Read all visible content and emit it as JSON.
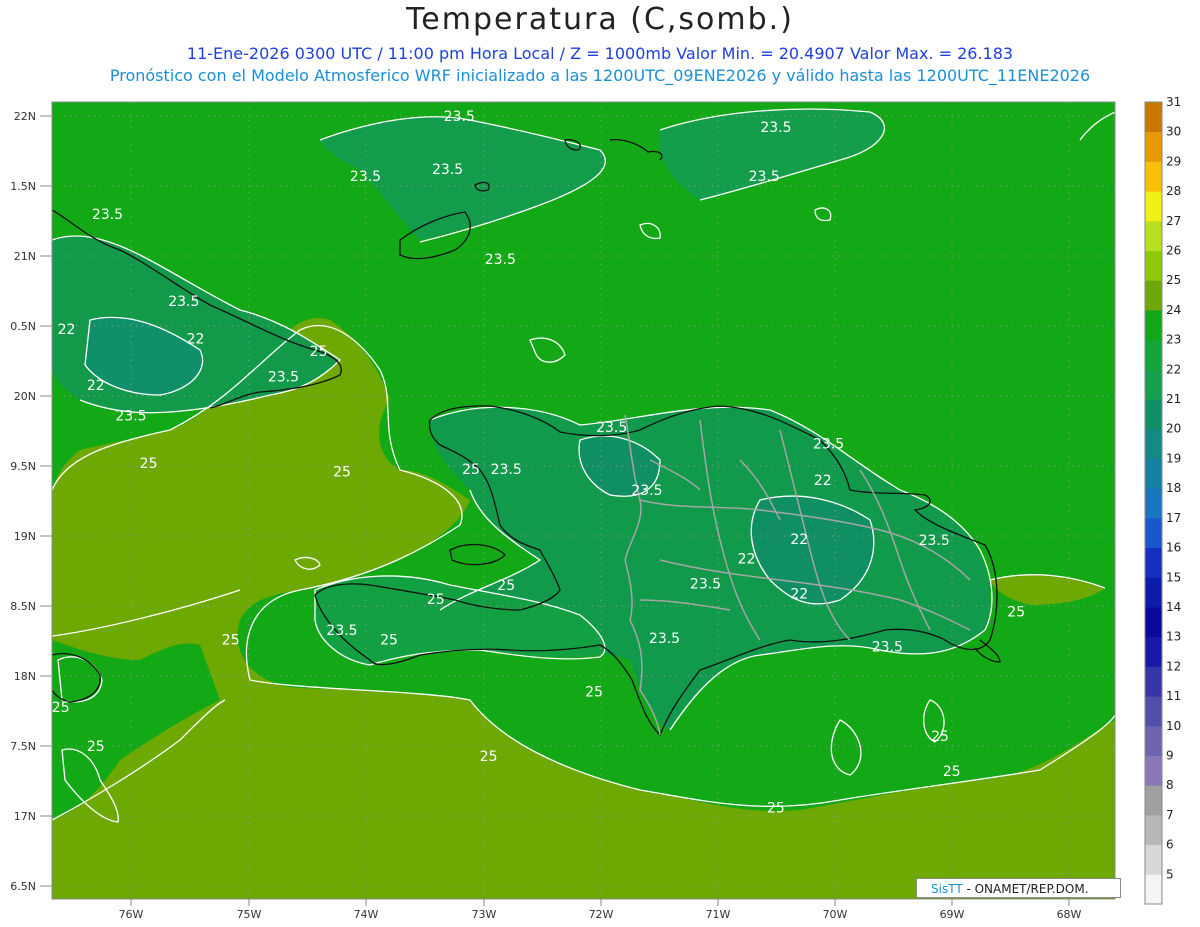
{
  "header": {
    "title": "Temperatura (C,somb.)",
    "subtitle1": "11-Ene-2026 0300 UTC / 11:00 pm Hora Local / Z = 1000mb   Valor Min. = 20.4907  Valor Max. = 26.183",
    "subtitle2": "Pronóstico con el Modelo Atmosferico WRF inicializado a las 1200UTC_09ENE2026 y válido hasta las  1200UTC_11ENE2026"
  },
  "map": {
    "lat_ticks": [
      "22N",
      "1.5N",
      "21N",
      "0.5N",
      "20N",
      "9.5N",
      "19N",
      "8.5N",
      "18N",
      "7.5N",
      "17N",
      "6.5N"
    ],
    "lon_ticks": [
      "76W",
      "75W",
      "74W",
      "73W",
      "72W",
      "71W",
      "70W",
      "69W",
      "68W"
    ],
    "contour_labels": [
      {
        "text": "23.5",
        "lon": -73.2,
        "lat": 22.0
      },
      {
        "text": "23.5",
        "lon": -70.5,
        "lat": 21.92
      },
      {
        "text": "23.5",
        "lon": -74.0,
        "lat": 21.57
      },
      {
        "text": "23.5",
        "lon": -73.3,
        "lat": 21.62
      },
      {
        "text": "23.5",
        "lon": -70.6,
        "lat": 21.57
      },
      {
        "text": "23.5",
        "lon": -76.2,
        "lat": 21.3
      },
      {
        "text": "23.5",
        "lon": -72.85,
        "lat": 20.98
      },
      {
        "text": "23.5",
        "lon": -75.55,
        "lat": 20.68
      },
      {
        "text": "22",
        "lon": -76.55,
        "lat": 20.48
      },
      {
        "text": "22",
        "lon": -75.45,
        "lat": 20.41
      },
      {
        "text": "25",
        "lon": -74.4,
        "lat": 20.32
      },
      {
        "text": "22",
        "lon": -76.3,
        "lat": 20.08
      },
      {
        "text": "23.5",
        "lon": -74.7,
        "lat": 20.14
      },
      {
        "text": "23.5",
        "lon": -76.0,
        "lat": 19.86
      },
      {
        "text": "23.5",
        "lon": -71.9,
        "lat": 19.78
      },
      {
        "text": "23.5",
        "lon": -70.05,
        "lat": 19.66
      },
      {
        "text": "25",
        "lon": -75.85,
        "lat": 19.52
      },
      {
        "text": "25",
        "lon": -74.2,
        "lat": 19.46
      },
      {
        "text": "25",
        "lon": -73.1,
        "lat": 19.48
      },
      {
        "text": "23.5",
        "lon": -72.8,
        "lat": 19.48
      },
      {
        "text": "22",
        "lon": -70.1,
        "lat": 19.4
      },
      {
        "text": "23.5",
        "lon": -71.6,
        "lat": 19.33
      },
      {
        "text": "22",
        "lon": -70.3,
        "lat": 18.98
      },
      {
        "text": "23.5",
        "lon": -69.15,
        "lat": 18.97
      },
      {
        "text": "22",
        "lon": -70.75,
        "lat": 18.84
      },
      {
        "text": "25",
        "lon": -72.8,
        "lat": 18.65
      },
      {
        "text": "23.5",
        "lon": -71.1,
        "lat": 18.66
      },
      {
        "text": "22",
        "lon": -70.3,
        "lat": 18.59
      },
      {
        "text": "25",
        "lon": -73.4,
        "lat": 18.55
      },
      {
        "text": "25",
        "lon": -68.45,
        "lat": 18.46
      },
      {
        "text": "23.5",
        "lon": -74.2,
        "lat": 18.33
      },
      {
        "text": "25",
        "lon": -75.15,
        "lat": 18.26
      },
      {
        "text": "25",
        "lon": -73.8,
        "lat": 18.26
      },
      {
        "text": "23.5",
        "lon": -71.45,
        "lat": 18.27
      },
      {
        "text": "23.5",
        "lon": -69.55,
        "lat": 18.21
      },
      {
        "text": "25",
        "lon": -72.05,
        "lat": 17.89
      },
      {
        "text": "25",
        "lon": -76.6,
        "lat": 17.78
      },
      {
        "text": "25",
        "lon": -69.1,
        "lat": 17.57
      },
      {
        "text": "25",
        "lon": -76.3,
        "lat": 17.5
      },
      {
        "text": "25",
        "lon": -72.95,
        "lat": 17.43
      },
      {
        "text": "25",
        "lon": -69.0,
        "lat": 17.32
      },
      {
        "text": "25",
        "lon": -70.5,
        "lat": 17.06
      }
    ]
  },
  "colorbar": {
    "labels": [
      "5",
      "6",
      "7",
      "8",
      "9",
      "10",
      "11",
      "12",
      "13",
      "14",
      "15",
      "16",
      "17",
      "18",
      "19",
      "20",
      "21",
      "22",
      "23",
      "24",
      "25",
      "26",
      "27",
      "28",
      "29",
      "30",
      "31"
    ],
    "colors": [
      "#f4f4f4",
      "#d8d8d8",
      "#b8b8b8",
      "#a0a0a0",
      "#8a77b8",
      "#6f64b0",
      "#5050aa",
      "#3636a8",
      "#1818a6",
      "#0a0a9a",
      "#0c1ca8",
      "#1530c0",
      "#1a56cc",
      "#1a76c0",
      "#1580a0",
      "#138a86",
      "#108f68",
      "#15a050",
      "#12a63a",
      "#10a818",
      "#6fa80a",
      "#8ec808",
      "#b8e020",
      "#f2f015",
      "#f8c008",
      "#e89a05",
      "#c87a00"
    ]
  },
  "credit": {
    "brand": "SisTT",
    "text": " - ONAMET/REP.DOM."
  },
  "colors": {
    "sea_warm": "#6ea802",
    "sea_mid": "#12a816",
    "land_cool": "#129a4a",
    "contour": "#ffffff",
    "coast": "#111111",
    "borders": "#a0a0a0"
  }
}
